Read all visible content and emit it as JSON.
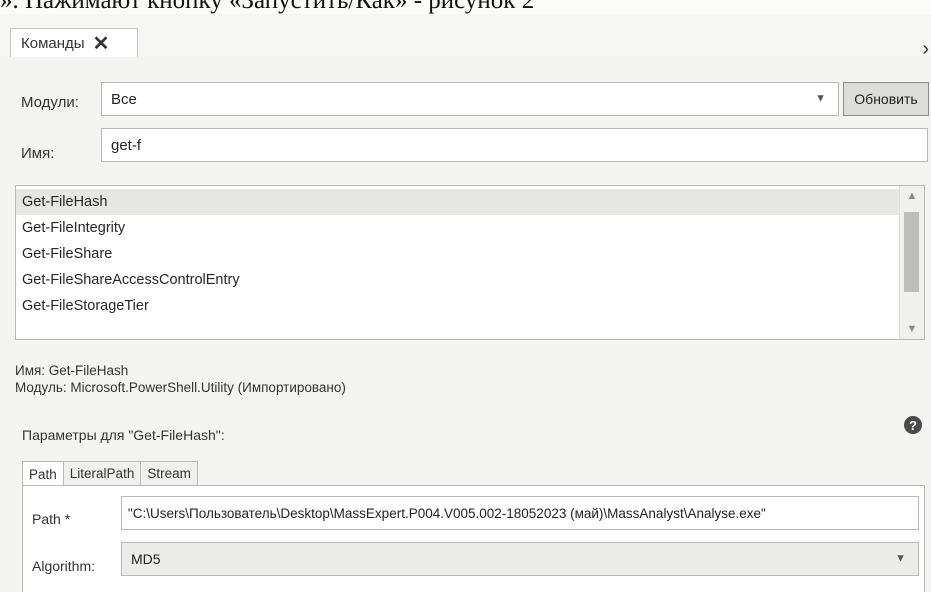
{
  "document_text": "». Нажимают кнопку «Запустить/Как» - рисунок 2",
  "tab": {
    "label": "Команды",
    "close_glyph": "✕"
  },
  "pane_arrow": "›",
  "modules": {
    "label": "Модули:",
    "value": "Все",
    "refresh_label": "Обновить"
  },
  "name": {
    "label": "Имя:",
    "value": "get-f"
  },
  "commands": [
    {
      "label": "Get-FileHash",
      "selected": true
    },
    {
      "label": "Get-FileIntegrity",
      "selected": false
    },
    {
      "label": "Get-FileShare",
      "selected": false
    },
    {
      "label": "Get-FileShareAccessControlEntry",
      "selected": false
    },
    {
      "label": "Get-FileStorageTier",
      "selected": false
    }
  ],
  "details": {
    "name_line": "Имя: Get-FileHash",
    "module_line": "Модуль: Microsoft.PowerShell.Utility (Импортировано)"
  },
  "params_heading": "Параметры для \"Get-FileHash\":",
  "help_icon": "?",
  "param_tabs": [
    {
      "label": "Path",
      "active": true
    },
    {
      "label": "LiteralPath",
      "active": false
    },
    {
      "label": "Stream",
      "active": false
    }
  ],
  "path_param": {
    "label": "Path *",
    "value": "\"C:\\Users\\Пользователь\\Desktop\\MassExpert.P004.V005.002-18052023 (май)\\MassAnalyst\\Analyse.exe\""
  },
  "algorithm_param": {
    "label": "Algorithm:",
    "value": "MD5"
  },
  "icons": {
    "tab_close": "close-icon",
    "dropdown": "chevron-down-icon",
    "help": "help-icon"
  }
}
